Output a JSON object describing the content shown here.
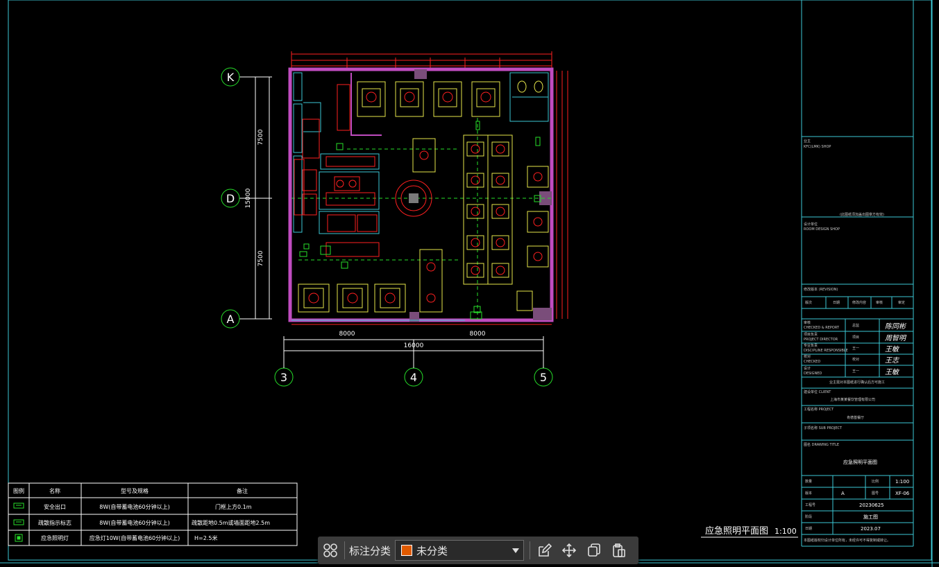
{
  "drawing": {
    "axis_labels": {
      "k": "K",
      "d": "D",
      "a": "A",
      "c3": "3",
      "c4": "4",
      "c5": "5"
    },
    "dims": {
      "left_top": "7500",
      "left_mid": "15000",
      "left_bot": "7500",
      "bottom_left": "8000",
      "bottom_total": "16000",
      "bottom_right": "8000"
    },
    "title_text": "应急照明平面图",
    "scale_text": "1:100"
  },
  "legend": {
    "headers": [
      "图例",
      "名称",
      "型号及规格",
      "备注"
    ],
    "rows": [
      {
        "name": "安全出口",
        "spec": "8W(自带蓄电池60分钟以上)",
        "note": "门框上方0.1m"
      },
      {
        "name": "疏散指示标志",
        "spec": "8W(自带蓄电池60分钟以上)",
        "note": "疏散距地0.5m或墙面距地2.5m"
      },
      {
        "name": "应急照明灯",
        "spec": "应急灯10W(自带蓄电池60分钟以上)",
        "note": "H=2.5米"
      }
    ]
  },
  "titleblock": {
    "owner_label": "业主",
    "owner_value": "KFC(LMK) SHOP",
    "stamp_note": "(此图纸须加盖出图章方有效)",
    "design_unit_label": "设计单位",
    "design_unit_value": "ROOM DESIGN SHOP",
    "revision_label": "修改版本 (REVISION)",
    "rev_headers": [
      "版次",
      "日期",
      "修改内容",
      "审核",
      "审定"
    ],
    "staff": [
      {
        "role": "审核",
        "sub": "CHECKED & REPORT",
        "title": "总监",
        "sign": "陈同彬"
      },
      {
        "role": "项目负责",
        "sub": "PROJECT DIRECTOR",
        "title": "项目",
        "sign": "周智明"
      },
      {
        "role": "专业负责",
        "sub": "DISCIPLINE RESPONSIBLE",
        "title": "王一",
        "sign": "王敏"
      },
      {
        "role": "校对",
        "sub": "CHECKED",
        "title": "校对",
        "sign": "王志"
      },
      {
        "role": "设计",
        "sub": "DESIGNED",
        "title": "王一",
        "sign": "王敏"
      }
    ],
    "client_note": "业主需对本图纸进行确认后方可施工",
    "client_label": "建设单位 CLIENT",
    "client_value": "上海市某某餐饮管理有限公司",
    "project_label": "工程名称 PROJECT",
    "project_value": "肯德基餐厅",
    "subproject_label": "子项名称 SUB PROJECT",
    "drawing_title_label": "图名 DRAWING TITLE",
    "drawing_title_value": "应急照明平面图",
    "quantity_label": "数量",
    "scale_label": "比例",
    "scale_value": "1:100",
    "version_label": "版本",
    "version_value": "A",
    "drawing_no_label": "图号",
    "drawing_no_value": "XF-06",
    "project_no_label": "工程号",
    "project_no_value": "20230625",
    "stage_label": "阶段",
    "stage_value": "施工图",
    "date_label": "日期",
    "date_value": "2023.07",
    "footer_note": "本图纸版权归设计单位所有，未经许可不得复制或转让。"
  },
  "toolbar": {
    "label": "标注分类",
    "selected": "未分类",
    "swatch_color": "#e05a00"
  },
  "colors": {
    "wall": "#c04cc0",
    "cyan": "#3bc9d6",
    "red": "#ff2020",
    "yellow": "#e6e64a",
    "green": "#27e02a",
    "white": "#ffffff"
  }
}
